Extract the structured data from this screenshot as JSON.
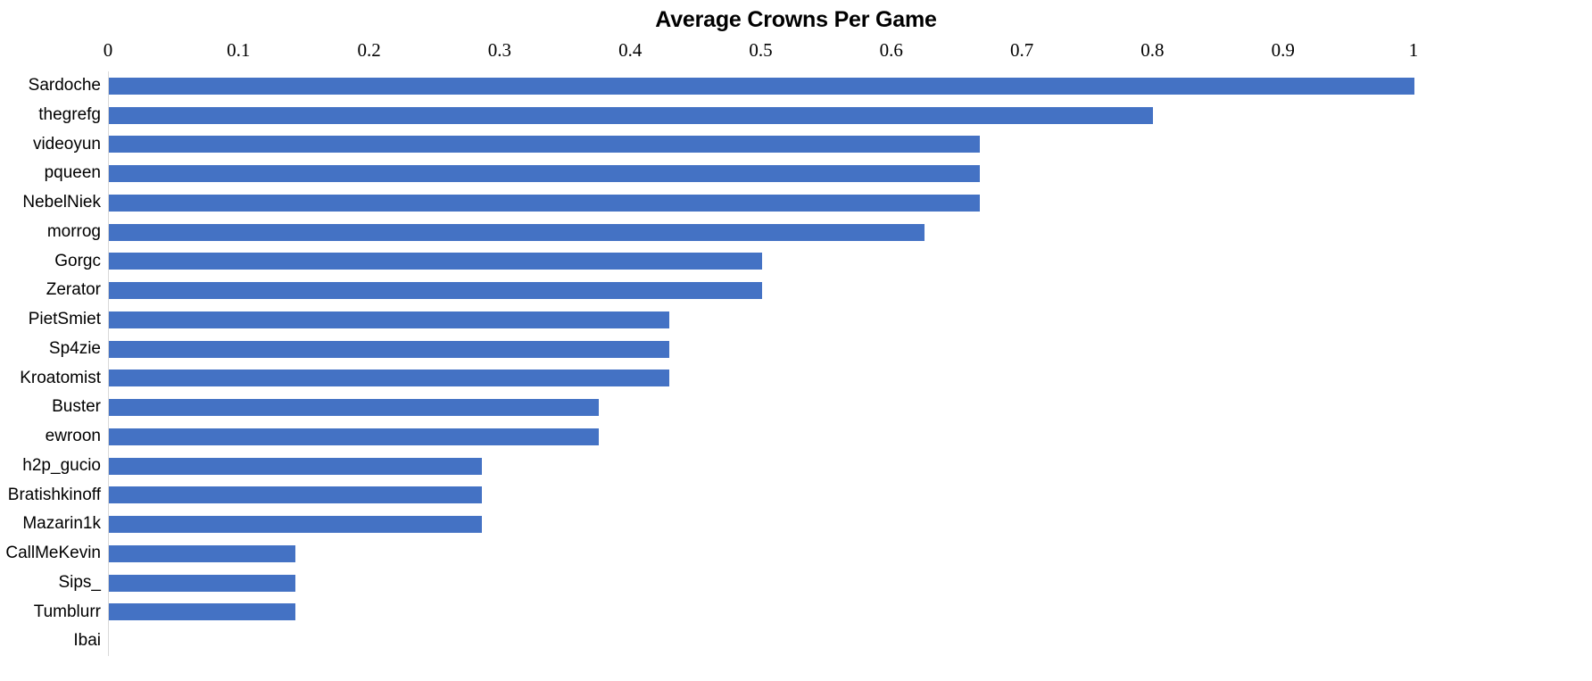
{
  "chart_data": {
    "type": "bar",
    "orientation": "horizontal",
    "title": "Average Crowns Per Game",
    "xlabel": "",
    "ylabel": "",
    "xlim": [
      0,
      1
    ],
    "xticks": [
      "0",
      "0.1",
      "0.2",
      "0.3",
      "0.4",
      "0.5",
      "0.6",
      "0.7",
      "0.8",
      "0.9",
      "1"
    ],
    "xtick_values": [
      0,
      0.1,
      0.2,
      0.3,
      0.4,
      0.5,
      0.6,
      0.7,
      0.8,
      0.9,
      1
    ],
    "grid": false,
    "legend": false,
    "bar_color": "#4472C4",
    "axis_line_color": "#D9D9D9",
    "categories": [
      "Sardoche",
      "thegrefg",
      "videoyun",
      "pqueen",
      "NebelNiek",
      "morrog",
      "Gorgc",
      "Zerator",
      "PietSmiet",
      "Sp4zie",
      "Kroatomist",
      "Buster",
      "ewroon",
      "h2p_gucio",
      "Bratishkinoff",
      "Mazarin1k",
      "CallMeKevin",
      "Sips_",
      "Tumblurr",
      "Ibai"
    ],
    "values": [
      1,
      0.8,
      0.667,
      0.667,
      0.667,
      0.625,
      0.5,
      0.5,
      0.429,
      0.429,
      0.429,
      0.375,
      0.375,
      0.286,
      0.286,
      0.286,
      0.143,
      0.143,
      0.143,
      0
    ]
  }
}
